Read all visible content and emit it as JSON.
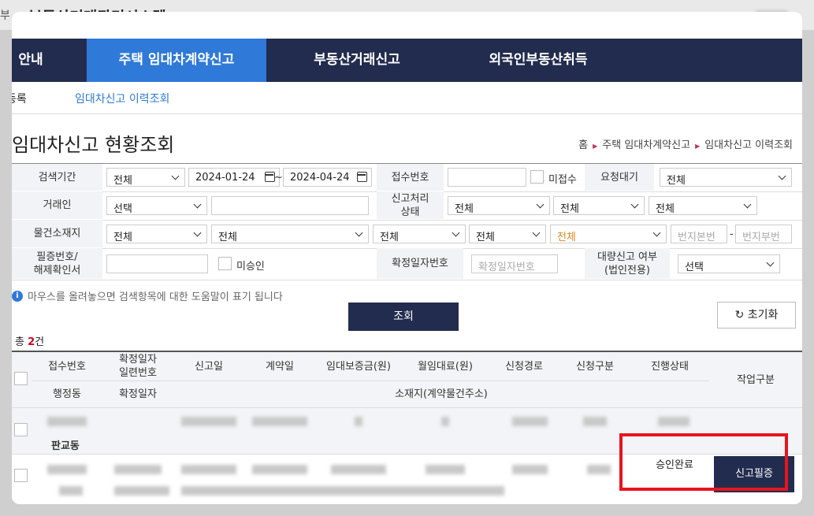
{
  "app": {
    "title": "부동산거래관리시스템",
    "prefix": "부"
  },
  "nav": {
    "items": [
      "안내",
      "주택 임대차계약신고",
      "부동산거래신고",
      "외국인부동산취득"
    ]
  },
  "subnav": {
    "items": [
      "등록",
      "임대차신고 이력조회"
    ]
  },
  "page": {
    "title": "임대차신고 현황조회"
  },
  "breadcrumb": {
    "home": "홈",
    "level1": "주택 임대차계약신고",
    "level2": "임대차신고 이력조회"
  },
  "search": {
    "period_label": "검색기간",
    "period_select": "전체",
    "date_from": "2024-01-24",
    "date_sep": "~",
    "date_to": "2024-04-24",
    "receipt_no_label": "접수번호",
    "not_received_label": "미접수",
    "request_label": "요청대기",
    "request_select": "전체",
    "party_label": "거래인",
    "party_select": "선택",
    "status_label": "신고처리\n상태",
    "status_sel1": "전체",
    "status_sel2": "전체",
    "status_sel3": "전체",
    "location_label": "물건소재지",
    "loc_sel1": "전체",
    "loc_sel2": "전체",
    "loc_sel3": "전체",
    "loc_sel4": "전체",
    "loc_sel5": "전체",
    "lot_main_placeholder": "번지본번",
    "lot_dash": "-",
    "lot_sub_placeholder": "번지부번",
    "cert_label": "필증번호/\n해제확인서",
    "unapproved_label": "미승인",
    "confirm_label": "확정일자번호",
    "confirm_placeholder": "확정일자번호",
    "bulk_label": "대량신고 여부\n(법인전용)",
    "bulk_select": "선택"
  },
  "hint": {
    "icon": "i",
    "text": "마우스를 올려놓으면 검색항목에 대한 도움말이 표기 됩니다"
  },
  "buttons": {
    "search": "조회",
    "reset": "초기화",
    "reset_icon": "↻"
  },
  "result": {
    "prefix": "총",
    "count": "2",
    "suffix": "건"
  },
  "table": {
    "headers_top": [
      "접수번호",
      "확정일자\n일련번호",
      "신고일",
      "계약일",
      "임대보증금(원)",
      "월임대료(원)",
      "신청경로",
      "신청구분",
      "진행상태",
      "작업구분"
    ],
    "headers_bottom": [
      "행정동",
      "확정일자",
      "소재지(계약물건주소)"
    ],
    "rows": [
      {
        "dong": "판교동"
      },
      {
        "status": "승인완료",
        "action": "신고필증"
      }
    ]
  },
  "colors": {
    "navy": "#222c4e",
    "blue": "#2f79d8",
    "highlight": "#e8141e"
  }
}
